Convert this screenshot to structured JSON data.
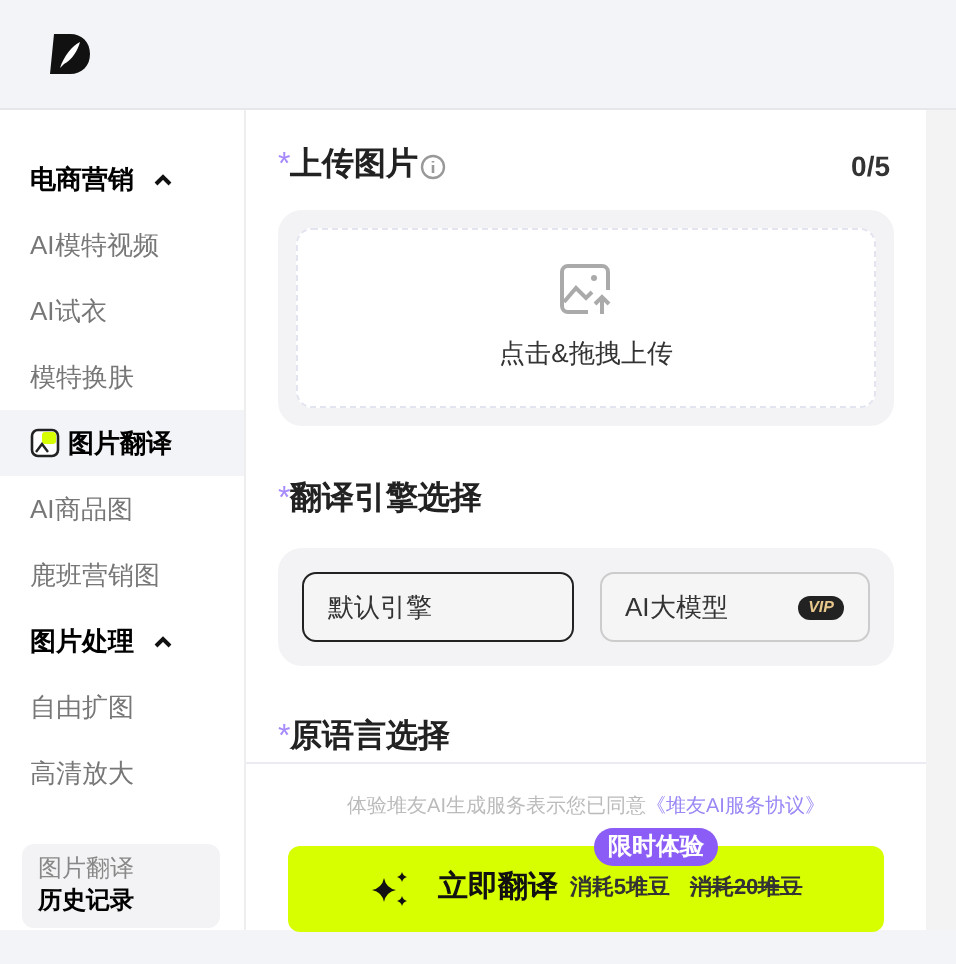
{
  "sidebar": {
    "groups": [
      {
        "title": "电商营销",
        "expanded": true,
        "items": [
          {
            "label": "AI模特视频",
            "selected": false
          },
          {
            "label": "AI试衣",
            "selected": false
          },
          {
            "label": "模特换肤",
            "selected": false
          },
          {
            "label": "图片翻译",
            "selected": true
          },
          {
            "label": "AI商品图",
            "selected": false
          },
          {
            "label": "鹿班营销图",
            "selected": false
          }
        ]
      },
      {
        "title": "图片处理",
        "expanded": true,
        "items": [
          {
            "label": "自由扩图",
            "selected": false
          },
          {
            "label": "高清放大",
            "selected": false
          }
        ]
      }
    ],
    "history": {
      "subtitle": "图片翻译",
      "title": "历史记录"
    }
  },
  "upload": {
    "required": "*",
    "title": "上传图片",
    "count": "0/5",
    "hint": "点击&拖拽上传"
  },
  "engine": {
    "required": "*",
    "title": "翻译引擎选择",
    "options": [
      {
        "label": "默认引擎",
        "selected": true
      },
      {
        "label": "AI大模型",
        "selected": false,
        "badge": "VIP"
      }
    ]
  },
  "source_language": {
    "required": "*",
    "title": "原语言选择"
  },
  "footer": {
    "agreement": "体验堆友AI生成服务表示您已同意",
    "agreement_link": "《堆友AI服务协议》",
    "promo_badge": "限时体验",
    "button": "立即翻译",
    "cost": "消耗5堆豆",
    "old_cost": "消耗20堆豆"
  }
}
